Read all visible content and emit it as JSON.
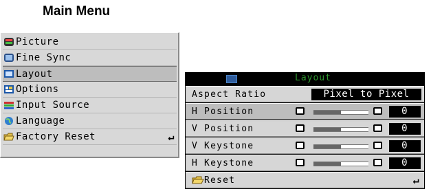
{
  "main_menu": {
    "title": "Main Menu",
    "items": [
      {
        "label": "Picture",
        "icon": "picture-icon"
      },
      {
        "label": "Fine Sync",
        "icon": "fine-sync-icon"
      },
      {
        "label": "Layout",
        "icon": "layout-icon",
        "selected": true
      },
      {
        "label": "Options",
        "icon": "options-icon"
      },
      {
        "label": "Input Source",
        "icon": "input-source-icon"
      },
      {
        "label": "Language",
        "icon": "globe-icon"
      },
      {
        "label": "Factory Reset",
        "icon": "folder-icon",
        "enter": "↵"
      }
    ]
  },
  "layout_menu": {
    "title": "Layout",
    "aspect_ratio": {
      "label": "Aspect Ratio",
      "value": "Pixel to Pixel"
    },
    "rows": [
      {
        "label": "H Position",
        "value": "0",
        "level": 0.5
      },
      {
        "label": "V Position",
        "value": "0",
        "level": 0.5
      },
      {
        "label": "V Keystone",
        "value": "0",
        "level": 0.5
      },
      {
        "label": "H Keystone",
        "value": "0",
        "level": 0.5
      }
    ],
    "reset": {
      "label": "Reset",
      "enter": "↵"
    }
  },
  "colors": {
    "menu_bg": "#d8d8d8",
    "selected_bg": "#bdbdbd",
    "header_text": "#2f9a2f",
    "value_box": "#000000"
  }
}
